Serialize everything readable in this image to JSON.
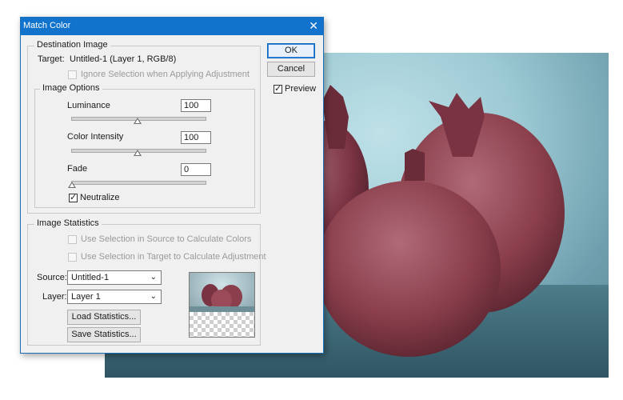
{
  "window": {
    "title": "Match Color"
  },
  "buttons": {
    "ok": "OK",
    "cancel": "Cancel",
    "load_statistics": "Load Statistics...",
    "save_statistics": "Save Statistics..."
  },
  "preview": {
    "label": "Preview",
    "checked": true
  },
  "destination": {
    "legend": "Destination Image",
    "target_label": "Target:",
    "target_value": "Untitled-1 (Layer 1, RGB/8)",
    "ignore_selection_label": "Ignore Selection when Applying Adjustment"
  },
  "image_options": {
    "legend": "Image Options",
    "luminance": {
      "label": "Luminance",
      "value": "100"
    },
    "color_intensity": {
      "label": "Color Intensity",
      "value": "100"
    },
    "fade": {
      "label": "Fade",
      "value": "0"
    },
    "neutralize": {
      "label": "Neutralize",
      "checked": true
    }
  },
  "image_statistics": {
    "legend": "Image Statistics",
    "use_source_label": "Use Selection in Source to Calculate Colors",
    "use_target_label": "Use Selection in Target to Calculate Adjustment",
    "source_label": "Source:",
    "source_value": "Untitled-1",
    "layer_label": "Layer:",
    "layer_value": "Layer 1"
  },
  "colors": {
    "titlebar": "#1173cc",
    "dialog_bg": "#f0f0f0",
    "photo_bg": "#9cc9d3",
    "fruit": "#8b3f4c"
  }
}
